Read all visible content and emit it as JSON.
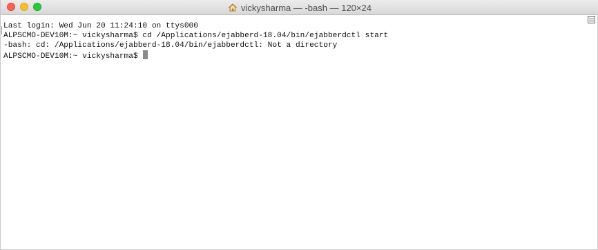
{
  "window": {
    "title": "vickysharma — -bash — 120×24",
    "icon": "home-icon"
  },
  "terminal": {
    "lines": [
      "Last login: Wed Jun 20 11:24:10 on ttys000",
      "ALPSCMO-DEV10M:~ vickysharma$ cd /Applications/ejabberd-18.04/bin/ejabberdctl start",
      "-bash: cd: /Applications/ejabberd-18.04/bin/ejabberdctl: Not a directory",
      "ALPSCMO-DEV10M:~ vickysharma$ "
    ]
  },
  "colors": {
    "close": "#fe5f57",
    "minimize": "#febc2e",
    "maximize": "#28c840",
    "text": "#111111",
    "background": "#ffffff"
  }
}
